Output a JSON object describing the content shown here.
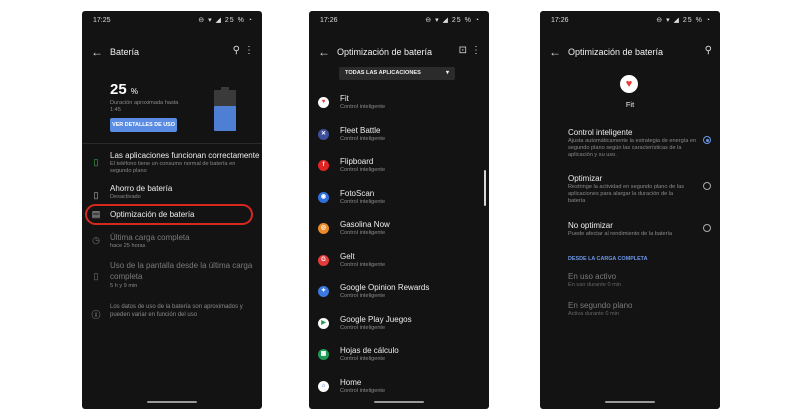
{
  "screen1": {
    "status": {
      "time": "17:25",
      "icons": "⊖ ▾ ◢ 25 % ◔"
    },
    "title": "Batería",
    "battery_percent": "25",
    "percent_sign": "%",
    "battery_level": 0.25,
    "duration_label": "Duración aproximada hasta",
    "duration_value": "1:45",
    "details_button": "VER DETALLES DE USO",
    "apps_ok_title": "Las aplicaciones funcionan correctamente",
    "apps_ok_sub1": "El teléfono tiene un consumo normal de batería en",
    "apps_ok_sub2": "segundo plano",
    "saver_title": "Ahorro de batería",
    "saver_sub": "Desactivado",
    "optimization_title": "Optimización de batería",
    "last_charge_title": "Última carga completa",
    "last_charge_sub": "hace 25 horas",
    "screen_use_title1": "Uso de la pantalla desde la última carga",
    "screen_use_title2": "completa",
    "screen_use_sub": "5 h y 9 min",
    "info_text1": "Los datos de uso de la batería son aproximados y",
    "info_text2": "pueden variar en función del uso",
    "highlight_color": "#d7281f"
  },
  "screen2": {
    "status": {
      "time": "17:26",
      "icons": "⊖ ▾ ◢ 25 % ◔"
    },
    "title": "Optimización de batería",
    "filter": "TODAS LAS APLICACIONES",
    "apps": [
      {
        "name": "Fit",
        "status": "Control inteligente",
        "glyph": "♥",
        "color": "#ffffff",
        "fg": "#e33"
      },
      {
        "name": "Fleet Battle",
        "status": "Control inteligente",
        "glyph": "✕",
        "color": "#3d4f9c",
        "fg": "#fff"
      },
      {
        "name": "Flipboard",
        "status": "Control inteligente",
        "glyph": "f",
        "color": "#e02424",
        "fg": "#fff"
      },
      {
        "name": "FotoScan",
        "status": "Control inteligente",
        "glyph": "◉",
        "color": "#2f6fdc",
        "fg": "#fff"
      },
      {
        "name": "Gasolina Now",
        "status": "Control inteligente",
        "glyph": "◎",
        "color": "#e8892a",
        "fg": "#fff"
      },
      {
        "name": "Gelt",
        "status": "Control inteligente",
        "glyph": "G",
        "color": "#e63a3a",
        "fg": "#fff"
      },
      {
        "name": "Google Opinion Rewards",
        "status": "Control inteligente",
        "glyph": "✦",
        "color": "#3c78dd",
        "fg": "#fff"
      },
      {
        "name": "Google Play Juegos",
        "status": "Control inteligente",
        "glyph": "▶",
        "color": "#ffffff",
        "fg": "#2a9d4b"
      },
      {
        "name": "Hojas de cálculo",
        "status": "Control inteligente",
        "glyph": "▦",
        "color": "#1e9b53",
        "fg": "#fff"
      },
      {
        "name": "Home",
        "status": "Control inteligente",
        "glyph": "⌂",
        "color": "#ffffff",
        "fg": "#3c78dd"
      }
    ]
  },
  "screen3": {
    "status": {
      "time": "17:26",
      "icons": "⊖ ▾ ◢ 25 % ◔"
    },
    "title": "Optimización de batería",
    "app_name": "Fit",
    "app_logo": "♥",
    "options": [
      {
        "title": "Control inteligente",
        "desc1": "Ajusta automáticamente la estrategia de energía en",
        "desc2": "segundo plano según las características de la",
        "desc3": "aplicación y su uso.",
        "selected": true
      },
      {
        "title": "Optimizar",
        "desc1": "Restringe la actividad en segundo plano de las",
        "desc2": "aplicaciones para alargar la duración de la",
        "desc3": "batería",
        "selected": false
      },
      {
        "title": "No optimizar",
        "desc1": "Puede afectar al rendimiento de la batería",
        "desc2": "",
        "desc3": "",
        "selected": false
      }
    ],
    "section_label": "DESDE LA CARGA COMPLETA",
    "active_title": "En uso activo",
    "active_sub": "En uso durante 0 min",
    "background_title": "En segundo plano",
    "background_sub": "Activa durante 0 min",
    "accent_color": "#6d97e8"
  }
}
